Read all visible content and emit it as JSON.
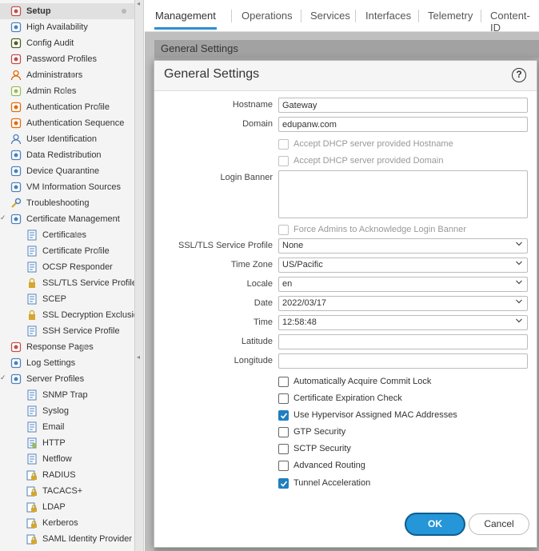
{
  "sidebar": {
    "items": [
      {
        "label": "Setup",
        "icon": "setup-icon",
        "dot": true,
        "selected": true
      },
      {
        "label": "High Availability",
        "icon": "ha-icon"
      },
      {
        "label": "Config Audit",
        "icon": "audit-icon"
      },
      {
        "label": "Password Profiles",
        "icon": "password-icon"
      },
      {
        "label": "Administrators",
        "icon": "admin-icon",
        "dot": true
      },
      {
        "label": "Admin Roles",
        "icon": "role-icon",
        "dot": true
      },
      {
        "label": "Authentication Profile",
        "icon": "auth-profile-icon",
        "dot": true
      },
      {
        "label": "Authentication Sequence",
        "icon": "auth-sequence-icon"
      },
      {
        "label": "User Identification",
        "icon": "user-id-icon"
      },
      {
        "label": "Data Redistribution",
        "icon": "redistribution-icon"
      },
      {
        "label": "Device Quarantine",
        "icon": "quarantine-icon"
      },
      {
        "label": "VM Information Sources",
        "icon": "vm-icon"
      },
      {
        "label": "Troubleshooting",
        "icon": "wrench-icon"
      },
      {
        "label": "Certificate Management",
        "icon": "certificate-icon",
        "expanded": true
      },
      {
        "label": "Certificates",
        "icon": "document-icon",
        "child": true,
        "dot": true
      },
      {
        "label": "Certificate Profile",
        "icon": "document-icon",
        "child": true,
        "dot": true
      },
      {
        "label": "OCSP Responder",
        "icon": "ocsp-icon",
        "child": true
      },
      {
        "label": "SSL/TLS Service Profile",
        "icon": "lock-icon",
        "child": true
      },
      {
        "label": "SCEP",
        "icon": "document-icon",
        "child": true
      },
      {
        "label": "SSL Decryption Exclusion",
        "icon": "lock-icon",
        "child": true
      },
      {
        "label": "SSH Service Profile",
        "icon": "document-icon",
        "child": true
      },
      {
        "label": "Response Pages",
        "icon": "response-icon",
        "dot": true
      },
      {
        "label": "Log Settings",
        "icon": "log-icon"
      },
      {
        "label": "Server Profiles",
        "icon": "server-icon",
        "expanded": true
      },
      {
        "label": "SNMP Trap",
        "icon": "document-icon",
        "child": true
      },
      {
        "label": "Syslog",
        "icon": "document-icon",
        "child": true
      },
      {
        "label": "Email",
        "icon": "document-icon",
        "child": true
      },
      {
        "label": "HTTP",
        "icon": "http-icon",
        "child": true
      },
      {
        "label": "Netflow",
        "icon": "document-icon",
        "child": true
      },
      {
        "label": "RADIUS",
        "icon": "folder-lock-icon",
        "child": true
      },
      {
        "label": "TACACS+",
        "icon": "folder-lock-icon",
        "child": true
      },
      {
        "label": "LDAP",
        "icon": "folder-lock-icon",
        "child": true
      },
      {
        "label": "Kerberos",
        "icon": "folder-lock-icon",
        "child": true
      },
      {
        "label": "SAML Identity Provider",
        "icon": "folder-lock-icon",
        "child": true
      }
    ]
  },
  "tabs": {
    "items": [
      "Management",
      "Operations",
      "Services",
      "Interfaces",
      "Telemetry",
      "Content-ID"
    ],
    "active": "Management"
  },
  "background_panel": {
    "title": "General Settings"
  },
  "dialog": {
    "title": "General Settings",
    "help_icon": "?",
    "fields": {
      "hostname": {
        "label": "Hostname",
        "value": "Gateway"
      },
      "domain": {
        "label": "Domain",
        "value": "edupanw.com"
      },
      "accept_dhcp_hostname": {
        "label": "Accept DHCP server provided Hostname",
        "checked": false
      },
      "accept_dhcp_domain": {
        "label": "Accept DHCP server provided Domain",
        "checked": false
      },
      "login_banner": {
        "label": "Login Banner",
        "value": ""
      },
      "force_admins": {
        "label": "Force Admins to Acknowledge Login Banner",
        "checked": false
      },
      "ssl_tls_profile": {
        "label": "SSL/TLS Service Profile",
        "value": "None"
      },
      "time_zone": {
        "label": "Time Zone",
        "value": "US/Pacific"
      },
      "locale": {
        "label": "Locale",
        "value": "en"
      },
      "date": {
        "label": "Date",
        "value": "2022/03/17"
      },
      "time": {
        "label": "Time",
        "value": "12:58:48"
      },
      "latitude": {
        "label": "Latitude",
        "value": ""
      },
      "longitude": {
        "label": "Longitude",
        "value": ""
      }
    },
    "options": [
      {
        "label": "Automatically Acquire Commit Lock",
        "checked": false
      },
      {
        "label": "Certificate Expiration Check",
        "checked": false
      },
      {
        "label": "Use Hypervisor Assigned MAC Addresses",
        "checked": true
      },
      {
        "label": "GTP Security",
        "checked": false
      },
      {
        "label": "SCTP Security",
        "checked": false
      },
      {
        "label": "Advanced Routing",
        "checked": false
      },
      {
        "label": "Tunnel Acceleration",
        "checked": true
      }
    ],
    "buttons": {
      "ok": "OK",
      "cancel": "Cancel"
    }
  },
  "colors": {
    "accent": "#2596d8",
    "checkbox_checked": "#1f7fc0"
  }
}
